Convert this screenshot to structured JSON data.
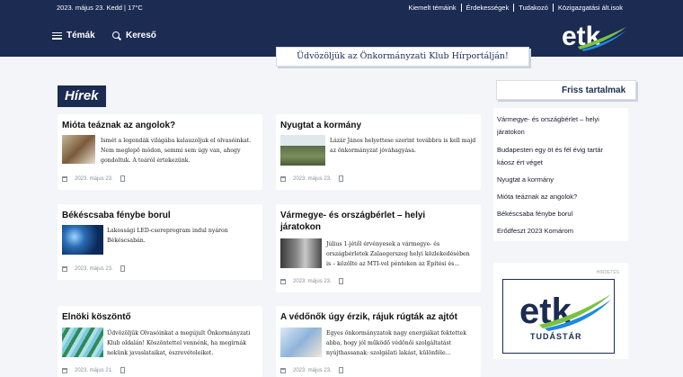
{
  "topbar": {
    "date_weather": "2023. május 23. Kedd  |  17°C",
    "links": [
      "Kiemelt témáink",
      "Érdekességek",
      "Tudakozó",
      "Közigazgatási ált.isok"
    ]
  },
  "nav": {
    "topics_label": "Témák",
    "search_label": "Kereső"
  },
  "logo": {
    "text": "etk",
    "icons": [
      "etk-logo"
    ]
  },
  "welcome": "Üdvözöljük az Önkormányzati Klub Hírportálján!",
  "section_title": "Hírek",
  "articles": [
    {
      "title": "Mióta teáznak az angolok?",
      "excerpt_lines": [
        "Ismét a legendák világába kalauzoljuk el olvasóinkat.",
        "Nem meglepő módon, semmi sem úgy van, ahogy",
        "gondoltuk. A teáról értekezünk."
      ],
      "date": "2023. május 23."
    },
    {
      "title": "Nyugtat a kormány",
      "excerpt_lines": [
        "Lázár János helyettese szerint továbbra is kell majd",
        "az önkormányzat jóváhagyása."
      ],
      "date": "2023. május 23."
    },
    {
      "title": "Békéscsaba fénybe borul",
      "excerpt_lines": [
        "Lakossági LED-csereprogram indul nyáron",
        "Békéscsabán."
      ],
      "date": "2023. május 23."
    },
    {
      "title_lines": [
        "Vármegye- és országbérlet – helyi",
        "járatokon"
      ],
      "excerpt_lines": [
        "Július 1-jétől érvényesek a vármegye- és",
        "országbérletek Zalaegerszeg helyi közlekedésében",
        "is – közölte az MTI-vel pénteken az Építési és..."
      ],
      "date": "2023. május 23."
    },
    {
      "title": "Elnöki köszöntő",
      "excerpt_lines": [
        "Üdvözöljük Olvasóinkat a megújult Önkormányzati",
        "Klub oldalán! Köszöntettel vennénk, ha megírnák",
        "nekünk javaslataikat, észrevételeiket."
      ],
      "date": "2023. május 21."
    },
    {
      "title": "A védőnők úgy érzik, rájuk rúgták az ajtót",
      "excerpt_lines": [
        "Egyes önkormányzatok nagy energiákat fektettek",
        "abba, hogy jól működő védőnői szolgáltatást",
        "nyújthassanak: szolgálati lakást, különféle..."
      ],
      "date": "2023. május 23."
    }
  ],
  "sidebar": {
    "heading": "Friss tartalmak",
    "items": [
      "Vármegye- és országbérlet – helyi",
      "járatokon",
      "Budapesten egy öt és fél évig tartár",
      "káosz ért véget",
      "Nyugtat a kormány",
      "Mióta teáznak az angolok?",
      "Békéscsaba fénybe borul",
      "Erődfeszt 2023 Komárom"
    ],
    "ad_label": "HIRDETÉS",
    "ad_logo": "etk",
    "ad_text": "TUDÁSTÁR"
  },
  "colors": {
    "navy": "#1b2b52",
    "green": "#7ac143",
    "blue": "#1e88e5"
  }
}
